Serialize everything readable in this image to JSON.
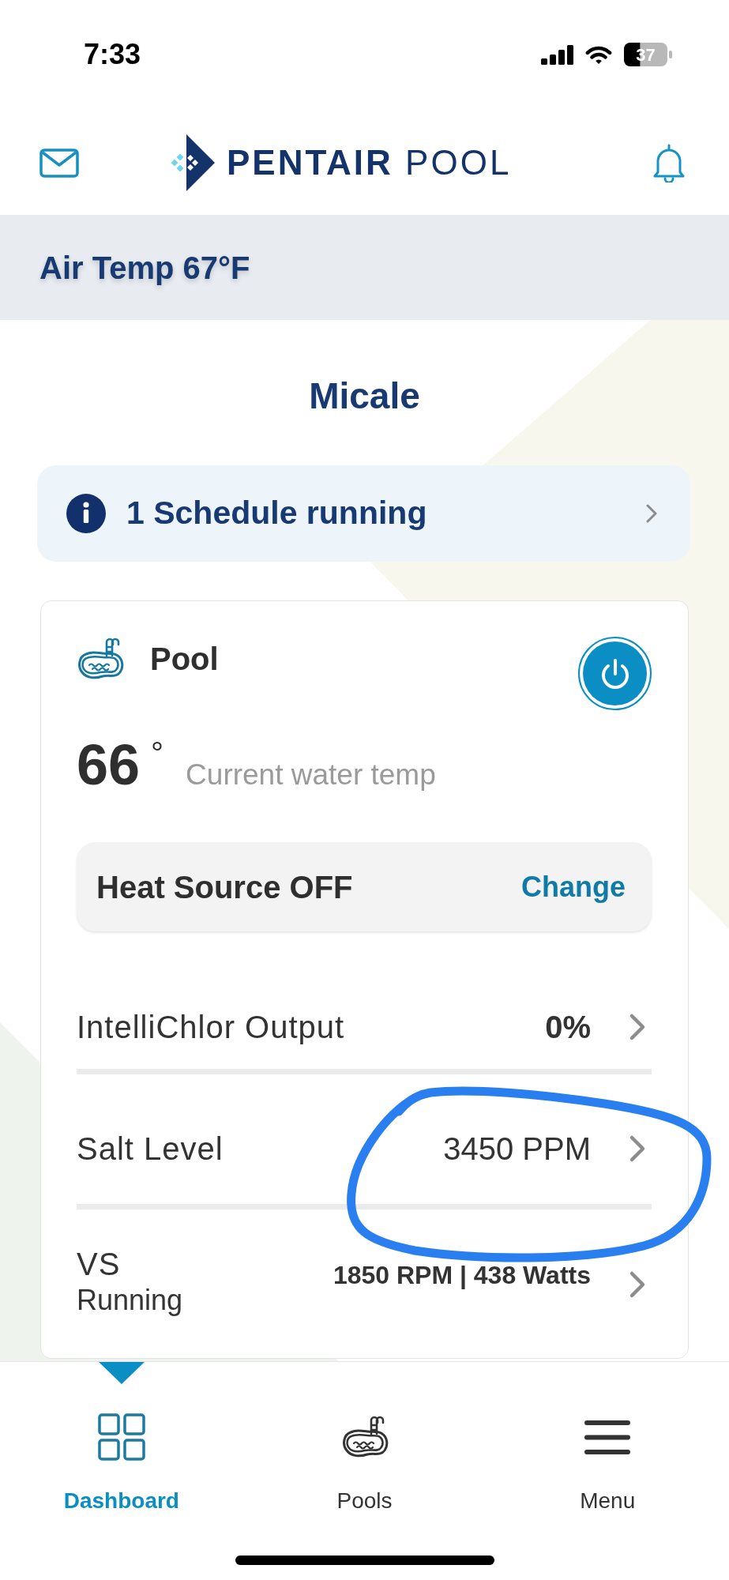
{
  "status_bar": {
    "time": "7:33",
    "battery": "37"
  },
  "header": {
    "logo": "**PENTAIR** POOL"
  },
  "air_temp": "Air Temp 67°F",
  "location": "Micale",
  "schedule_banner": {
    "text": "1 Schedule running"
  },
  "pool": {
    "name": "Pool",
    "power_on": true,
    "water_temp": "66",
    "degree": "°",
    "water_temp_label": "Current water temp",
    "heat_source": "Heat Source OFF",
    "heat_action": "Change",
    "rows": [
      {
        "kind": "percent",
        "label": "IntelliChlor Output",
        "value": "0%",
        "circled": false
      },
      {
        "kind": "reading",
        "label": "Salt Level",
        "value": "3450 PPM",
        "circled": true
      },
      {
        "kind": "pump",
        "label": "VS",
        "status": "Running",
        "value": "1850 RPM | 438 Watts",
        "circled": false
      }
    ]
  },
  "nav": [
    {
      "label": "Dashboard",
      "selected": true
    },
    {
      "label": "Pools",
      "selected": false
    },
    {
      "label": "Menu",
      "selected": false
    }
  ]
}
